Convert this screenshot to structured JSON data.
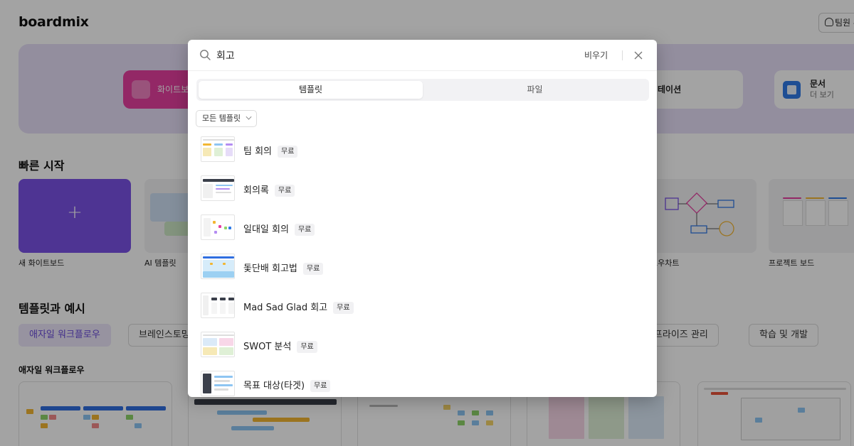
{
  "app": {
    "logo": "boardmix",
    "team_button": "팀원 추"
  },
  "hero": {
    "whiteboard_label": "화이트보",
    "presentation_label": "테이션",
    "document_title": "문서",
    "document_sub": "더 보기"
  },
  "quick_start": {
    "title": "빠른 시작",
    "plus": "+",
    "items": [
      {
        "label": "새 화이트보드"
      },
      {
        "label": "AI 템플릿"
      },
      {
        "label": "로우차트"
      },
      {
        "label": "프로젝트 보드"
      }
    ]
  },
  "templates_section": {
    "title": "템플릿과 예시",
    "chips": [
      "애자일 워크플로우",
      "브레인스토밍",
      "엔터프라이즈 관리",
      "학습 및 개발"
    ],
    "subsection": "애자일 워크플로우"
  },
  "modal": {
    "search": {
      "value": "회고",
      "clear_label": "비우기"
    },
    "tabs": [
      "템플릿",
      "파일"
    ],
    "active_tab": "템플릿",
    "filter_label": "모든 템플릿",
    "badge_label": "무료",
    "results": [
      {
        "name": "팀 회의",
        "badge": "무료"
      },
      {
        "name": "회의록",
        "badge": "무료"
      },
      {
        "name": "일대일 회의",
        "badge": "무료"
      },
      {
        "name": "돛단배 회고법",
        "badge": "무료"
      },
      {
        "name": "Mad Sad Glad 회고",
        "badge": "무료"
      },
      {
        "name": "SWOT 분석",
        "badge": "무료"
      },
      {
        "name": "목표 대상(타겟)",
        "badge": "무료"
      }
    ]
  },
  "colors": {
    "accent": "#7b52e6",
    "hero_bg": "#e7dff7",
    "whiteboard": "#e63fa0",
    "document": "#2f7be8",
    "overlay": "rgba(0,0,0,0.36)"
  },
  "icons": {
    "search": "search-icon",
    "close": "close-icon",
    "chevron": "chevron-down-icon",
    "user": "user-icon",
    "whiteboard": "whiteboard-icon",
    "document": "document-icon"
  }
}
